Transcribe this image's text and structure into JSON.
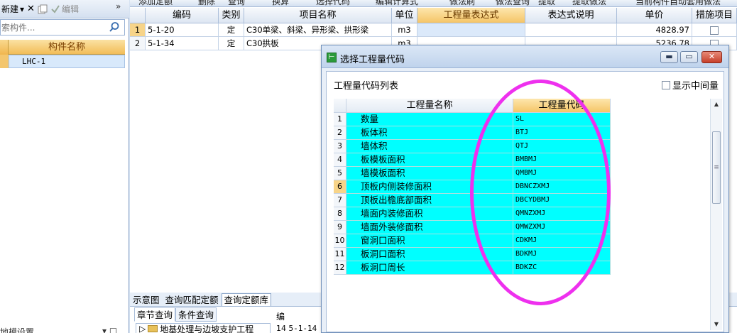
{
  "left_toolbar": {
    "new_label": "新建",
    "new_arrow": "▾",
    "delete_glyph": "✕",
    "edit_label": "编辑",
    "collapse_glyph": "»"
  },
  "search": {
    "placeholder": "索构件..."
  },
  "component_list": {
    "header": "构件名称",
    "rows": [
      {
        "name": "LHC-1"
      }
    ]
  },
  "left_bottom": {
    "label": "地模设置",
    "fragment": "▾ □"
  },
  "main_toolbar": {
    "fragments": [
      "添加定额",
      "删除",
      "查询",
      "换算",
      "选择代码",
      "编辑计算式",
      "做法刷",
      "做法查询",
      "提取",
      "提取做法",
      "当前构件自动套用做法"
    ]
  },
  "grid": {
    "headers": [
      "",
      "编码",
      "类别",
      "项目名称",
      "单位",
      "工程量表达式",
      "表达式说明",
      "单价",
      "措施项目"
    ],
    "rows": [
      {
        "num": "1",
        "code": "5-1-20",
        "type": "定",
        "name": "C30单梁、斜梁、异形梁、拱形梁",
        "unit": "m3",
        "expr": "",
        "desc": "",
        "price": "4828.97"
      },
      {
        "num": "2",
        "code": "5-1-34",
        "type": "定",
        "name": "C30拱板",
        "unit": "m3",
        "expr": "",
        "desc": "",
        "price": "5236.78"
      }
    ]
  },
  "bottom_tabs": [
    "示意图",
    "查询匹配定额",
    "查询定额库"
  ],
  "sub_tabs": [
    "章节查询",
    "条件查询"
  ],
  "tree": {
    "item": "地基处理与边坡支护工程"
  },
  "bottom_right": {
    "header": "编",
    "row_num": "14",
    "row_code": "5-1-14"
  },
  "dialog": {
    "title": "选择工程量代码",
    "list_caption": "工程量代码列表",
    "show_intermediate": "显示中间量",
    "columns": {
      "name": "工程量名称",
      "code": "工程量代码"
    },
    "rows": [
      {
        "num": "1",
        "name": "数量",
        "code": "SL"
      },
      {
        "num": "2",
        "name": "板体积",
        "code": "BTJ"
      },
      {
        "num": "3",
        "name": "墙体积",
        "code": "QTJ"
      },
      {
        "num": "4",
        "name": "板模板面积",
        "code": "BMBMJ"
      },
      {
        "num": "5",
        "name": "墙模板面积",
        "code": "QMBMJ"
      },
      {
        "num": "6",
        "name": "顶板内侧装修面积",
        "code": "DBNCZXMJ"
      },
      {
        "num": "7",
        "name": "顶板出檐底部面积",
        "code": "DBCYDBMJ"
      },
      {
        "num": "8",
        "name": "墙面内装修面积",
        "code": "QMNZXMJ"
      },
      {
        "num": "9",
        "name": "墙面外装修面积",
        "code": "QMWZXMJ"
      },
      {
        "num": "10",
        "name": "窗洞口面积",
        "code": "CDKMJ"
      },
      {
        "num": "11",
        "name": "板洞口面积",
        "code": "BDKMJ"
      },
      {
        "num": "12",
        "name": "板洞口周长",
        "code": "BDKZC"
      }
    ],
    "active_row": "6"
  },
  "colors": {
    "cyan_cells": "#00ffff",
    "header_orange": "#f5c567",
    "annotation_magenta": "#ee30ee"
  }
}
